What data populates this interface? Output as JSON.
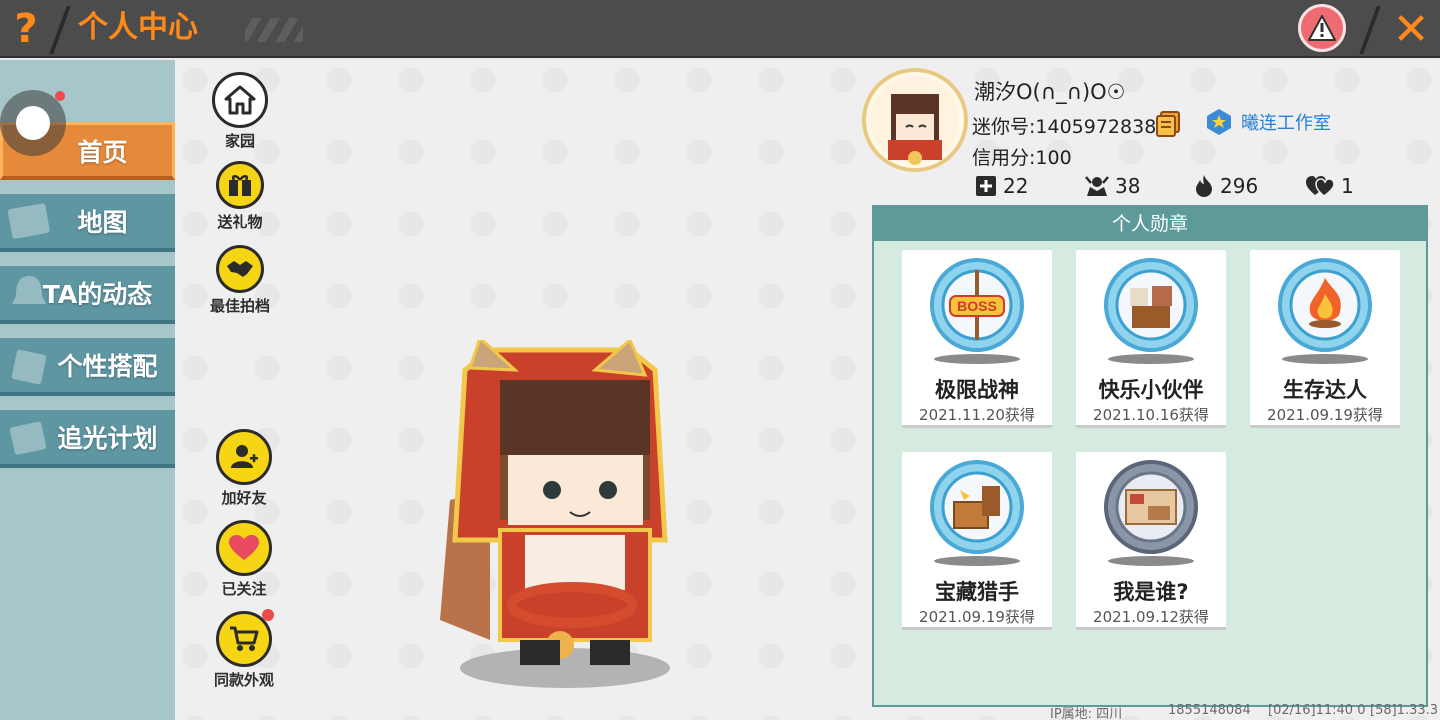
{
  "header": {
    "help_glyph": "?",
    "title": "个人中心",
    "close_glyph": "✕",
    "debug_text": "                 "
  },
  "sidebar": {
    "items": [
      {
        "label": "首页",
        "icon": "home-icon",
        "active": true
      },
      {
        "label": "地图",
        "icon": "map-icon"
      },
      {
        "label": "TA的动态",
        "icon": "bell-icon"
      },
      {
        "label": "个性搭配",
        "icon": "outfit-icon"
      },
      {
        "label": "追光计划",
        "icon": "plan-icon"
      }
    ]
  },
  "actions_top": [
    {
      "label": "家园",
      "icon": "house-icon"
    },
    {
      "label": "送礼物",
      "icon": "gift-icon"
    },
    {
      "label": "最佳拍档",
      "icon": "handshake-icon"
    }
  ],
  "actions_bottom": [
    {
      "label": "加好友",
      "icon": "add-friend-icon"
    },
    {
      "label": "已关注",
      "icon": "heart-icon"
    },
    {
      "label": "同款外观",
      "icon": "cart-icon",
      "badge": true
    }
  ],
  "profile": {
    "name": "潮汐O(∩_∩)O☉",
    "mini_id": "迷你号:1405972838",
    "credit": "信用分:100",
    "studio": "曦连工作室",
    "stats": [
      {
        "icon": "plus-square-icon",
        "value": "22"
      },
      {
        "icon": "fans-icon",
        "value": "38"
      },
      {
        "icon": "fire-icon",
        "value": "296"
      },
      {
        "icon": "hearts-icon",
        "value": "1"
      }
    ]
  },
  "medals": {
    "title": "个人勋章",
    "items": [
      {
        "name": "极限战神",
        "date": "2021.11.20获得",
        "icon": "boss-medal-icon"
      },
      {
        "name": "快乐小伙伴",
        "date": "2021.10.16获得",
        "icon": "friends-medal-icon"
      },
      {
        "name": "生存达人",
        "date": "2021.09.19获得",
        "icon": "fire-medal-icon"
      },
      {
        "name": "宝藏猎手",
        "date": "2021.09.19获得",
        "icon": "treasure-medal-icon"
      },
      {
        "name": "我是谁?",
        "date": "2021.09.12获得",
        "icon": "letter-medal-icon"
      }
    ]
  },
  "footer": {
    "ip": "IP属地: 四川",
    "uid": "1855148084",
    "time": "[02/16]11:40 0",
    "version": "[58]1.33.3"
  },
  "colors": {
    "accent": "#ff8a1a",
    "header_bg": "#4c4c4c",
    "sidebar_bg": "#a7c6c9",
    "nav_item": "#5e96a2",
    "nav_active": "#e58a3a",
    "panel_bg": "#d6ebdf",
    "panel_header": "#5e9a9a",
    "action_yellow": "#f6d514",
    "studio_blue": "#2a80d6"
  }
}
